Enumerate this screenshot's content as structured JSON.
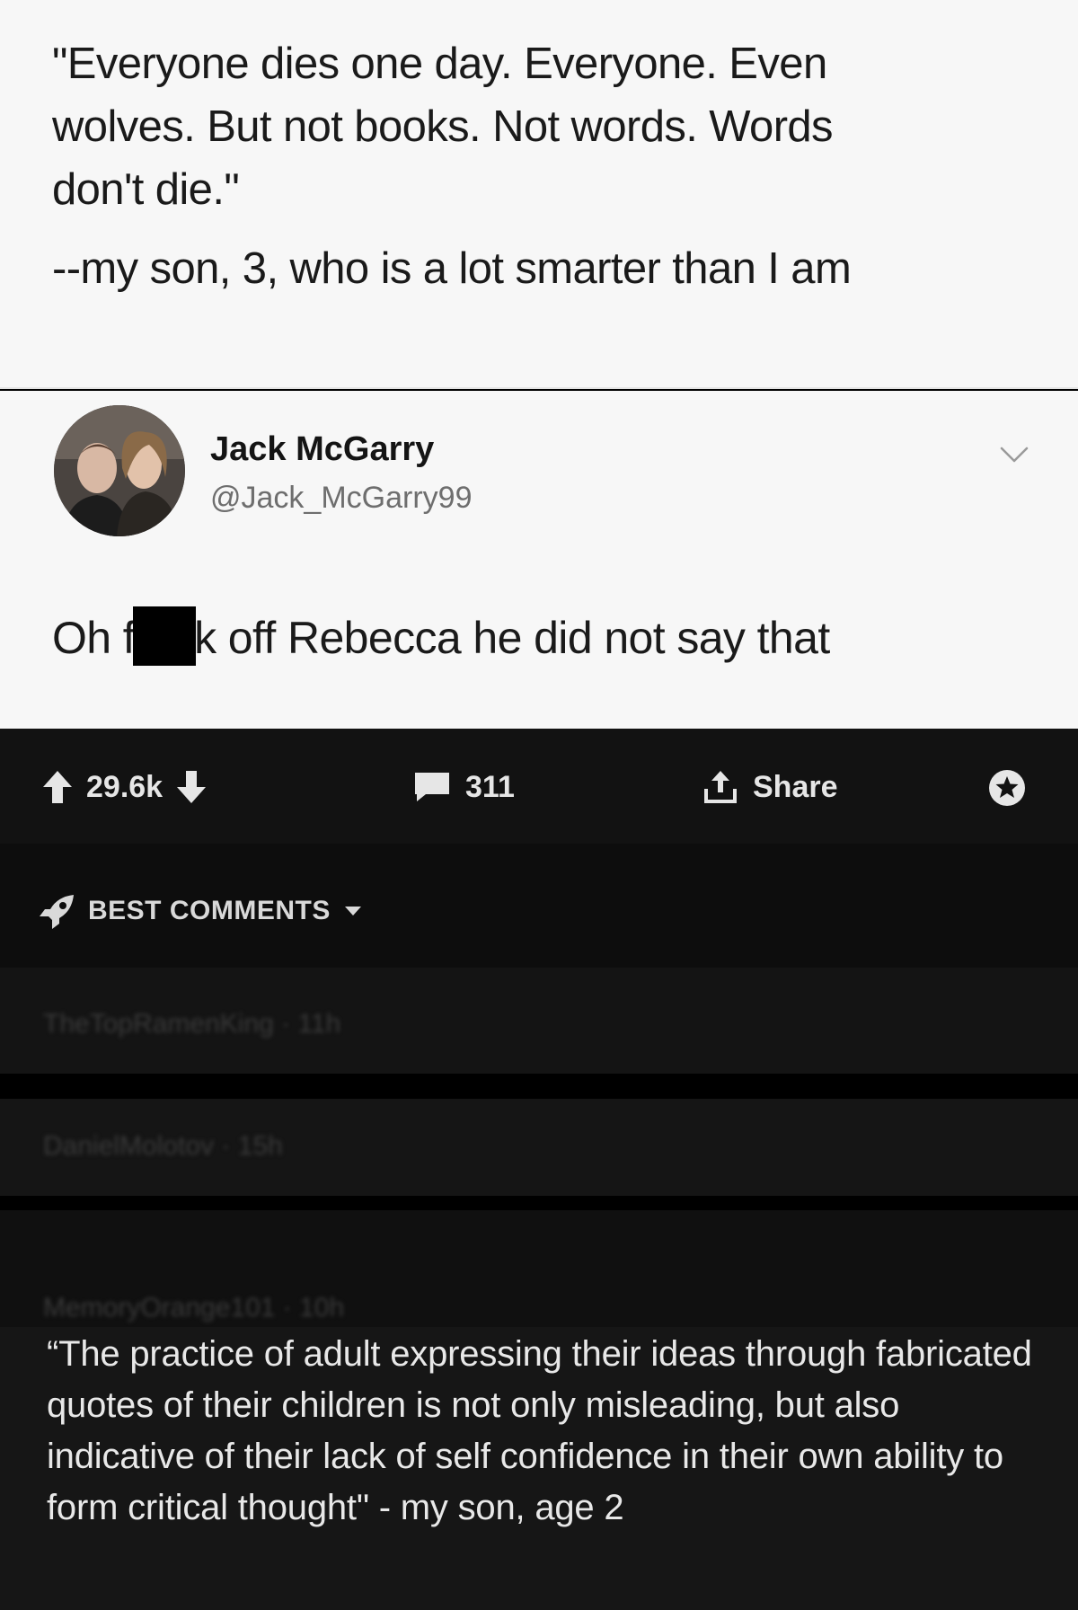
{
  "tweet": {
    "quote_lines": [
      "\"Everyone dies one day. Everyone. Even",
      "wolves. But not books. Not words. Words",
      "don't die.\""
    ],
    "attribution": "--my son, 3, who is a lot smarter than I am"
  },
  "reply": {
    "author_name": "Jack McGarry",
    "author_handle": "@Jack_McGarry99",
    "text_before": "Oh f",
    "text_after": "k off Rebecca he did not say that"
  },
  "actions": {
    "upvotes": "29.6k",
    "comments": "311",
    "share_label": "Share"
  },
  "comments_section": {
    "sort_label": "BEST COMMENTS",
    "blurred_meta": [
      "TheTopRamenKing · 11h",
      "DanielMolotov · 15h",
      "MemoryOrange101 · 10h"
    ],
    "featured_comment": "“The practice of adult expressing their ideas through fabricated quotes of their children is not only misleading, but also indicative of their lack of self confidence in their own ability to form critical thought\" - my son, age 2"
  },
  "colors": {
    "light_bg": "#f7f7f7",
    "dark_bg": "#121212",
    "text_dark": "#1a1a1a",
    "text_light": "#e8e8e8"
  }
}
